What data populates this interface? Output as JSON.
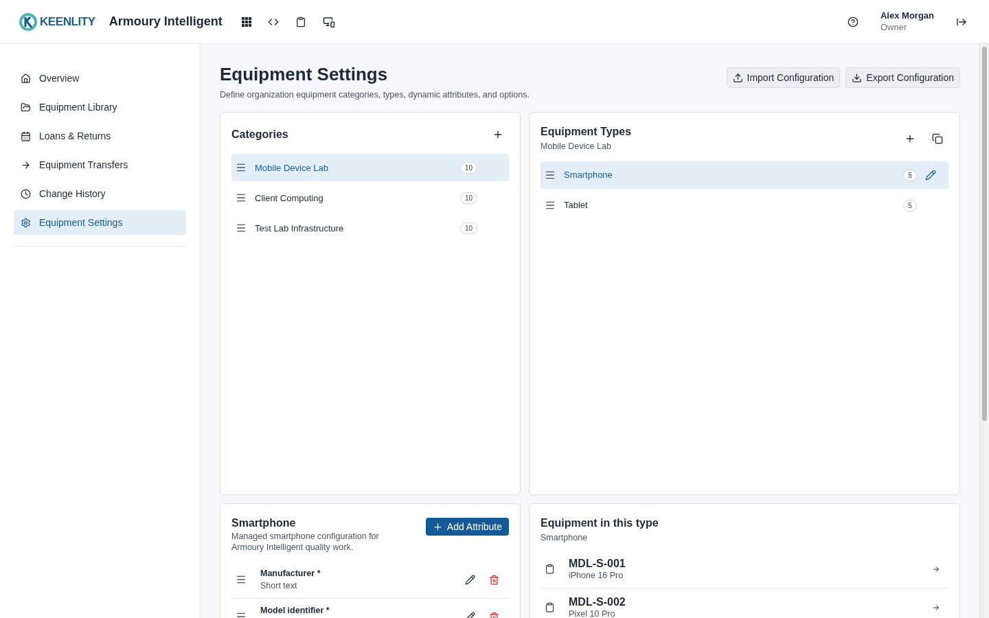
{
  "header": {
    "logo": "KEENLITY",
    "app_name": "Armoury Intelligent",
    "user_name": "Alex Morgan",
    "user_role": "Owner"
  },
  "sidebar": {
    "items": [
      {
        "label": "Overview",
        "selected": false
      },
      {
        "label": "Equipment Library",
        "selected": false
      },
      {
        "label": "Loans & Returns",
        "selected": false
      },
      {
        "label": "Equipment Transfers",
        "selected": false
      },
      {
        "label": "Change History",
        "selected": false
      },
      {
        "label": "Equipment Settings",
        "selected": true
      }
    ]
  },
  "page": {
    "title": "Equipment Settings",
    "subtitle": "Define organization equipment categories, types, dynamic attributes, and options.",
    "buttons": [
      {
        "label": "Import Configuration",
        "kind": "import"
      },
      {
        "label": "Export Configuration",
        "kind": "export"
      }
    ]
  },
  "categories": {
    "title": "Categories",
    "items": [
      {
        "label": "Mobile Device Lab",
        "count": "10",
        "selected": true
      },
      {
        "label": "Client Computing",
        "count": "10",
        "selected": false
      },
      {
        "label": "Test Lab Infrastructure",
        "count": "10",
        "selected": false
      }
    ]
  },
  "equipment_types": {
    "title": "Equipment Types",
    "subtitle": "Mobile Device Lab",
    "items": [
      {
        "label": "Smartphone",
        "count": "5",
        "selected": true
      },
      {
        "label": "Tablet",
        "count": "5",
        "selected": false
      }
    ]
  },
  "attributes": {
    "title": "Smartphone",
    "description": "Managed smartphone configuration for Armoury Intelligent quality work.",
    "add_button": "Add Attribute",
    "items": [
      {
        "name": "Manufacturer *",
        "type": "Short text"
      },
      {
        "name": "Model identifier *"
      }
    ]
  },
  "equipment": {
    "title": "Equipment in this type",
    "subtitle": "Smartphone",
    "items": [
      {
        "code": "MDL-S-001",
        "model": "iPhone 16 Pro"
      },
      {
        "code": "MDL-S-002",
        "model": "Pixel 10 Pro"
      }
    ]
  }
}
